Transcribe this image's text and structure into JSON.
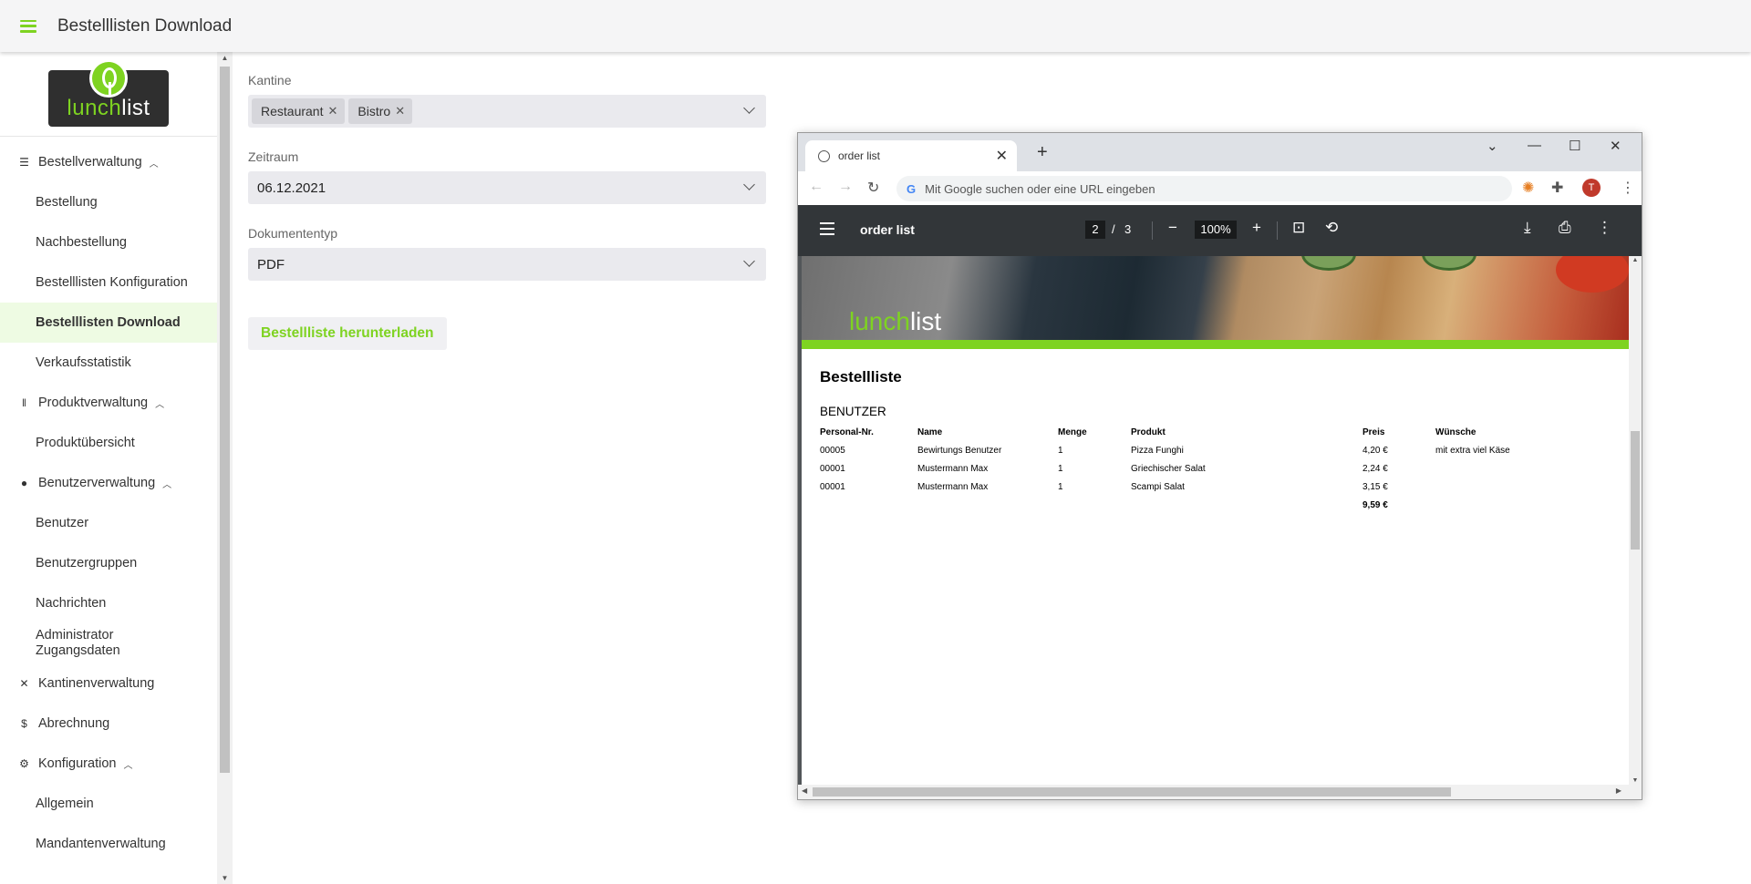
{
  "header": {
    "title": "Bestelllisten Download"
  },
  "logo": {
    "part1": "lunch",
    "part2": "list"
  },
  "sidebar": {
    "groups": [
      {
        "label": "Bestellverwaltung",
        "items": [
          "Bestellung",
          "Nachbestellung",
          "Bestelllisten Konfiguration",
          "Bestelllisten Download",
          "Verkaufsstatistik"
        ]
      },
      {
        "label": "Produktverwaltung",
        "items": [
          "Produktübersicht"
        ]
      },
      {
        "label": "Benutzerverwaltung",
        "items": [
          "Benutzer",
          "Benutzergruppen",
          "Nachrichten",
          "Administrator Zugangsdaten"
        ]
      },
      {
        "label": "Kantinenverwaltung"
      },
      {
        "label": "Abrechnung"
      },
      {
        "label": "Konfiguration",
        "items": [
          "Allgemein",
          "Mandantenverwaltung"
        ]
      }
    ],
    "active_item": "Bestelllisten Download"
  },
  "form": {
    "kantine": {
      "label": "Kantine",
      "chips": [
        "Restaurant",
        "Bistro"
      ]
    },
    "zeitraum": {
      "label": "Zeitraum",
      "value": "06.12.2021"
    },
    "dokumententyp": {
      "label": "Dokumententyp",
      "value": "PDF"
    },
    "download_button": "Bestellliste herunterladen"
  },
  "browser": {
    "tab_title": "order list",
    "omnibox_placeholder": "Mit Google suchen oder eine URL eingeben",
    "avatar_letter": "T",
    "pdf": {
      "title": "order list",
      "current_page": "2",
      "page_separator": "/",
      "total_pages": "3",
      "zoom": "100%",
      "doc_title": "Bestellliste",
      "section": "BENUTZER",
      "columns": [
        "Personal-Nr.",
        "Name",
        "Menge",
        "Produkt",
        "Preis",
        "Wünsche"
      ],
      "rows": [
        [
          "00005",
          "Bewirtungs Benutzer",
          "1",
          "Pizza Funghi",
          "4,20 €",
          "mit extra viel Käse"
        ],
        [
          "00001",
          "Mustermann Max",
          "1",
          "Griechischer Salat",
          "2,24 €",
          ""
        ],
        [
          "00001",
          "Mustermann Max",
          "1",
          "Scampi Salat",
          "3,15 €",
          ""
        ]
      ],
      "total": "9,59 €"
    }
  },
  "colors": {
    "accent": "#7ed321",
    "pdf_toolbar": "#323639"
  }
}
